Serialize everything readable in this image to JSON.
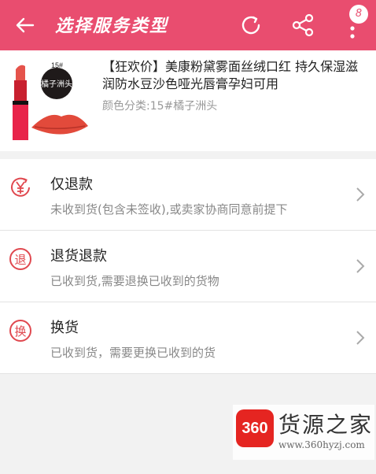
{
  "header": {
    "title": "选择服务类型",
    "badge_count": "8",
    "icons": [
      "arrow-left-icon",
      "refresh-icon",
      "share-icon",
      "more-vertical-icon"
    ],
    "background_color": "#e94d6f"
  },
  "product": {
    "title": "【狂欢价】美康粉黛雾面丝绒口红 持久保湿滋润防水豆沙色哑光唇膏孕妇可用",
    "spec": "颜色分类:15#橘子洲头",
    "thumbnail": {
      "label_number": "15#",
      "label_name": "橘子洲头"
    }
  },
  "options": [
    {
      "icon": "refund-yen-icon",
      "title": "仅退款",
      "desc": "未收到货(包含未签收),或卖家协商同意前提下"
    },
    {
      "icon": "return-icon",
      "title": "退货退款",
      "desc": "已收到货,需要退换已收到的货物"
    },
    {
      "icon": "exchange-icon",
      "title": "换货",
      "desc": "已收到货，需要更换已收到的货"
    }
  ],
  "watermark": {
    "logo": "360",
    "text": "货源之家",
    "url": "www.360hyzj.com"
  }
}
